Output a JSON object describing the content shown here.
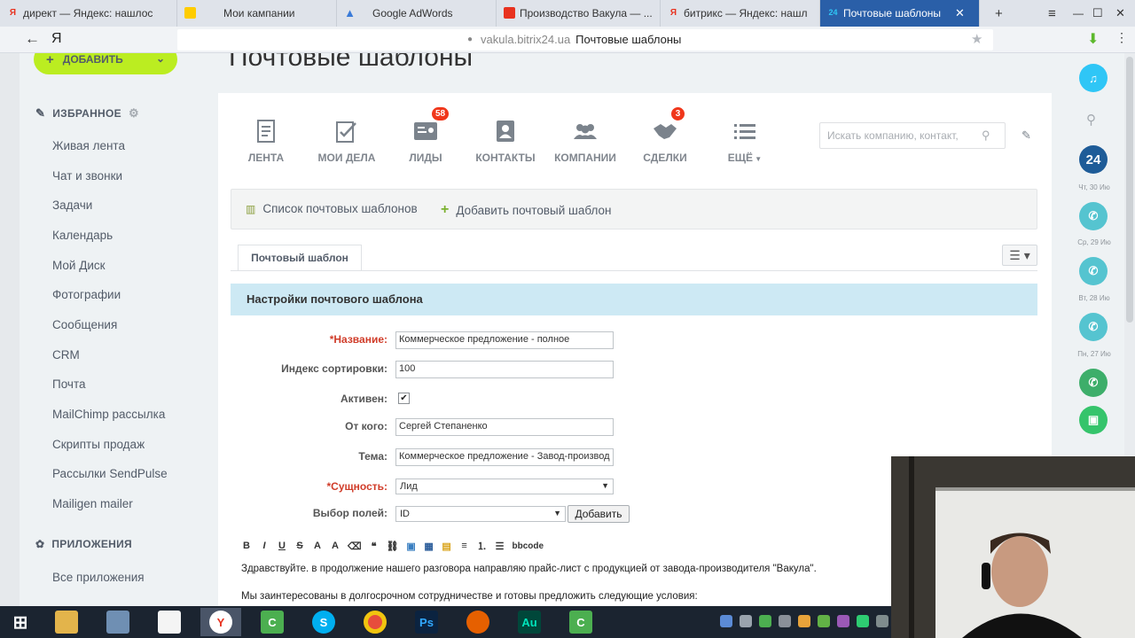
{
  "browser": {
    "tabs": [
      {
        "label": "директ — Яндекс: нашлос",
        "icon": "yandex-icon",
        "color": "#e8321f",
        "active": false
      },
      {
        "label": "Мои кампании",
        "icon": "yandex-direct-icon",
        "color": "#ffcc00",
        "active": false
      },
      {
        "label": "Google AdWords",
        "icon": "adwords-icon",
        "color": "#3b7bd8",
        "active": false
      },
      {
        "label": "Производство Вакула — ...",
        "icon": "bitrix-icon",
        "color": "#e8321f",
        "active": false
      },
      {
        "label": "битрикс — Яндекс: нашл",
        "icon": "yandex-icon",
        "color": "#e8321f",
        "active": false
      },
      {
        "label": "Почтовые шаблоны",
        "icon": "bitrix24-icon",
        "color": "#2fc6f6",
        "active": true
      }
    ],
    "new_tab": "+",
    "menu_icon": "≡",
    "minimize": "—",
    "maximize": "☐",
    "close": "✕",
    "url_domain": "vakula.bitrix24.ua",
    "url_title": "Почтовые шаблоны",
    "back": "←",
    "yandex_logo": "Я"
  },
  "sidebar": {
    "add_label": "ДОБАВИТЬ",
    "favorites_label": "ИЗБРАННОЕ",
    "items": [
      "Живая лента",
      "Чат и звонки",
      "Задачи",
      "Календарь",
      "Мой Диск",
      "Фотографии",
      "Сообщения",
      "CRM",
      "Почта",
      "MailChimp рассылка",
      "Скрипты продаж",
      "Рассылки SendPulse",
      "Mailigen mailer"
    ],
    "apps_label": "ПРИЛОЖЕНИЯ",
    "apps_items": [
      "Все приложения"
    ]
  },
  "page": {
    "title": "Почтовые шаблоны"
  },
  "crm_bar": {
    "items": [
      {
        "label": "ЛЕНТА",
        "icon": "feed-icon",
        "badge": ""
      },
      {
        "label": "МОИ ДЕЛА",
        "icon": "tasks-icon",
        "badge": ""
      },
      {
        "label": "ЛИДЫ",
        "icon": "leads-icon",
        "badge": "58"
      },
      {
        "label": "КОНТАКТЫ",
        "icon": "contacts-icon",
        "badge": ""
      },
      {
        "label": "КОМПАНИИ",
        "icon": "companies-icon",
        "badge": ""
      },
      {
        "label": "СДЕЛКИ",
        "icon": "deals-icon",
        "badge": "3"
      },
      {
        "label": "ЕЩЁ",
        "icon": "more-icon",
        "badge": ""
      }
    ],
    "search_placeholder": "Искать компанию, контакт,"
  },
  "toolbar": {
    "list_label": "Список почтовых шаблонов",
    "add_label": "Добавить почтовый шаблон"
  },
  "form": {
    "tab_label": "Почтовый шаблон",
    "section_title": "Настройки почтового шаблона",
    "fields": {
      "name_label": "*Название:",
      "name_value": "Коммерческое предложение - полное",
      "sort_label": "Индекс сортировки:",
      "sort_value": "100",
      "active_label": "Активен:",
      "active_checked": "✔",
      "from_label": "От кого:",
      "from_value": "Сергей Степаненко",
      "subject_label": "Тема:",
      "subject_value": "Коммерческое предложение - Завод-производ",
      "entity_label": "*Сущность:",
      "entity_value": "Лид",
      "fields_label": "Выбор полей:",
      "fields_value": "ID",
      "add_button": "Добавить"
    },
    "editor_tools": [
      "B",
      "I",
      "U",
      "S",
      "bbcode"
    ],
    "body_lines": [
      "Здравствуйте. в продолжение нашего разговора направляю прайс-лист с продукцией от завода-производителя \"Вакула\".",
      "Мы заинтересованы в долгосрочном сотрудничестве и готовы предложить следующие условия:"
    ]
  },
  "right_panel": {
    "counter": "24",
    "dates": [
      "Чт, 30 Ию",
      "Ср, 29 Ию",
      "Вт, 28 Ию",
      "Пн, 27 Ию"
    ]
  }
}
